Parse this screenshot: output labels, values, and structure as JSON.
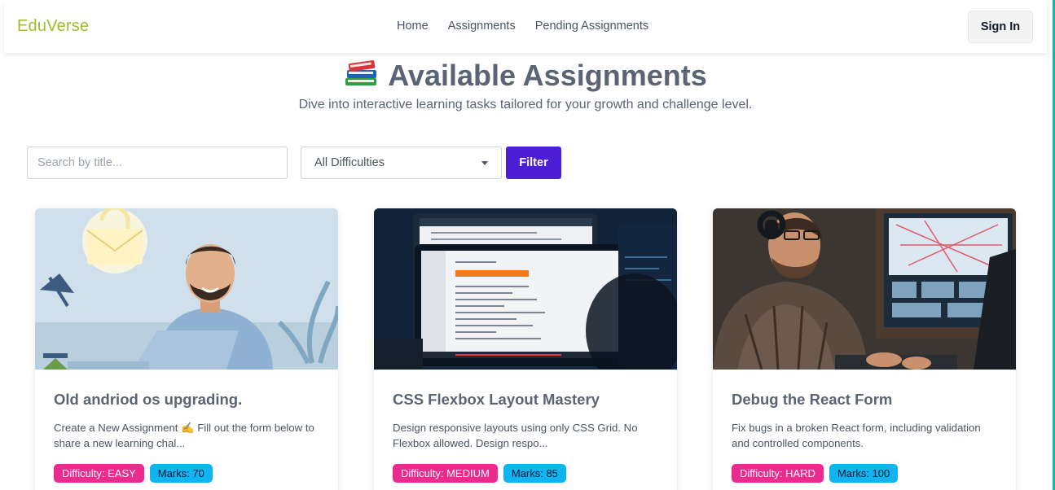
{
  "navbar": {
    "brand": "EduVerse",
    "links": [
      "Home",
      "Assignments",
      "Pending Assignments"
    ],
    "signin_label": "Sign In"
  },
  "hero": {
    "emoji": "📚",
    "title": "Available Assignments",
    "subtitle": "Dive into interactive learning tasks tailored for your growth and challenge level."
  },
  "filters": {
    "search_placeholder": "Search by title...",
    "search_value": "",
    "difficulty_selected": "All Difficulties",
    "filter_label": "Filter"
  },
  "cards": [
    {
      "title": "Old andriod os upgrading.",
      "description": "Create a New Assignment ✍️ Fill out the form below to share a new learning chal...",
      "difficulty": "Difficulty: EASY",
      "marks": "Marks: 70"
    },
    {
      "title": "CSS Flexbox Layout Mastery",
      "description": "Design responsive layouts using only CSS Grid. No Flexbox allowed. Design respo...",
      "difficulty": "Difficulty: MEDIUM",
      "marks": "Marks: 85"
    },
    {
      "title": "Debug the React Form",
      "description": "Fix bugs in a broken React form, including validation and controlled components.",
      "difficulty": "Difficulty: HARD",
      "marks": "Marks: 100"
    }
  ],
  "colors": {
    "brand": "#9cbd2c",
    "primary": "#4c1fd6",
    "difficulty_badge": "#ec2b8f",
    "marks_badge": "#10b4f0"
  }
}
